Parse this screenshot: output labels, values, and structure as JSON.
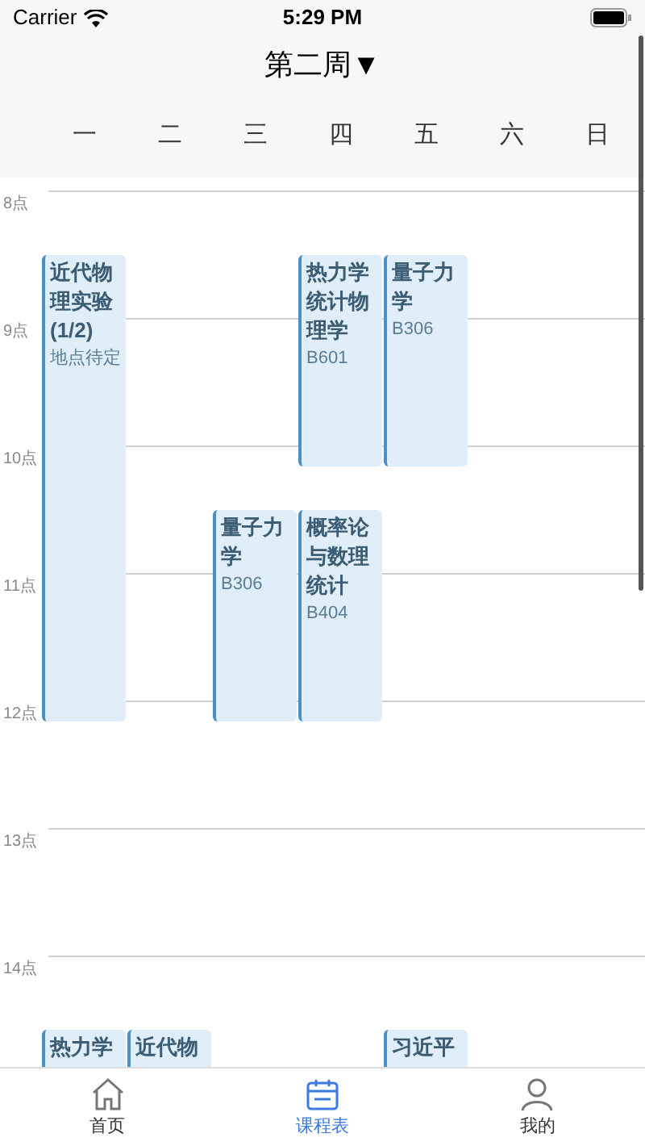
{
  "status_bar": {
    "carrier": "Carrier",
    "time": "5:29 PM"
  },
  "header": {
    "title": "第二周",
    "dropdown_glyph": "▼"
  },
  "hours": [
    "8点",
    "9点",
    "10点",
    "11点",
    "12点",
    "13点",
    "14点"
  ],
  "days": [
    {
      "label": "一",
      "courses": [
        {
          "kind": "morning",
          "name": "近代物理实验(1/2)",
          "location": "地点待定"
        },
        {
          "kind": "afternoon",
          "name": "热力学"
        }
      ]
    },
    {
      "label": "二",
      "courses": [
        {
          "kind": "afternoon",
          "name": "近代物"
        }
      ]
    },
    {
      "label": "三",
      "courses": [
        {
          "kind": "late",
          "name": "量子力学",
          "location": "B306"
        }
      ]
    },
    {
      "label": "四",
      "courses": [
        {
          "kind": "early",
          "name": "热力学统计物理学",
          "location": "B601"
        },
        {
          "kind": "late",
          "name": "概率论与数理统计",
          "location": "B404"
        }
      ]
    },
    {
      "label": "五",
      "courses": [
        {
          "kind": "early",
          "name": "量子力学",
          "location": "B306"
        },
        {
          "kind": "afternoon",
          "name": "习近平"
        }
      ]
    },
    {
      "label": "六"
    },
    {
      "label": "日"
    }
  ],
  "tab_bar": [
    {
      "label": "首页",
      "selected": false
    },
    {
      "label": "课程表",
      "selected": true
    },
    {
      "label": "我的",
      "selected": false
    }
  ]
}
